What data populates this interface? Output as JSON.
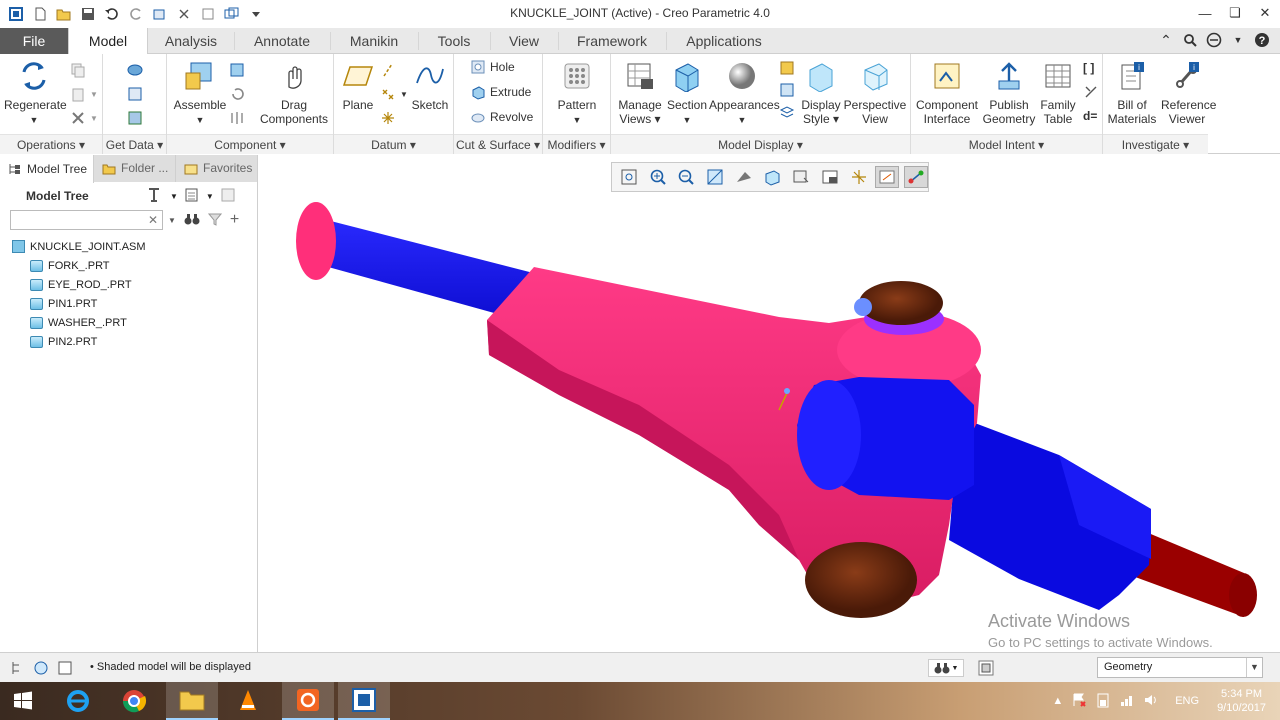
{
  "window": {
    "title": "KNUCKLE_JOINT (Active) - Creo Parametric 4.0"
  },
  "tabs": [
    "File",
    "Model",
    "Analysis",
    "Annotate",
    "Manikin",
    "Tools",
    "View",
    "Framework",
    "Applications"
  ],
  "ribbon": {
    "operations": {
      "label": "Operations",
      "regenerate": "Regenerate"
    },
    "get_data": {
      "label": "Get Data"
    },
    "component": {
      "label": "Component",
      "assemble": "Assemble",
      "drag": "Drag\nComponents"
    },
    "datum": {
      "label": "Datum",
      "plane": "Plane",
      "sketch": "Sketch"
    },
    "cut_surface": {
      "label": "Cut & Surface",
      "hole": "Hole",
      "extrude": "Extrude",
      "revolve": "Revolve"
    },
    "modifiers": {
      "label": "Modifiers",
      "pattern": "Pattern"
    },
    "model_display": {
      "label": "Model Display",
      "manage_views": "Manage\nViews",
      "section": "Section",
      "appearances": "Appearances",
      "display_style": "Display\nStyle",
      "perspective": "Perspective\nView"
    },
    "model_intent": {
      "label": "Model Intent",
      "component_interface": "Component\nInterface",
      "publish": "Publish\nGeometry",
      "family_table": "Family\nTable",
      "d_eq": "d="
    },
    "investigate": {
      "label": "Investigate",
      "bom": "Bill of\nMaterials",
      "reference_viewer": "Reference\nViewer"
    }
  },
  "panel": {
    "tabs": {
      "model_tree": "Model Tree",
      "folder": "Folder ...",
      "favorites": "Favorites"
    },
    "heading": "Model Tree",
    "search_placeholder": "",
    "tree": {
      "root": "KNUCKLE_JOINT.ASM",
      "children": [
        "FORK_.PRT",
        "EYE_ROD_.PRT",
        "PIN1.PRT",
        "WASHER_.PRT",
        "PIN2.PRT"
      ]
    }
  },
  "viewport": {
    "watermark_title": "Activate Windows",
    "watermark_sub": "Go to PC settings to activate Windows."
  },
  "status": {
    "message": "Shaded model will be displayed",
    "filter": "Geometry"
  },
  "taskbar": {
    "lang": "ENG",
    "time": "5:34 PM",
    "date": "9/10/2017"
  },
  "colors": {
    "fork": "#f0246e",
    "rod": "#1010e8",
    "pin": "#6b2a10",
    "washer": "#9b30ff",
    "rod_end": "#a00000"
  }
}
